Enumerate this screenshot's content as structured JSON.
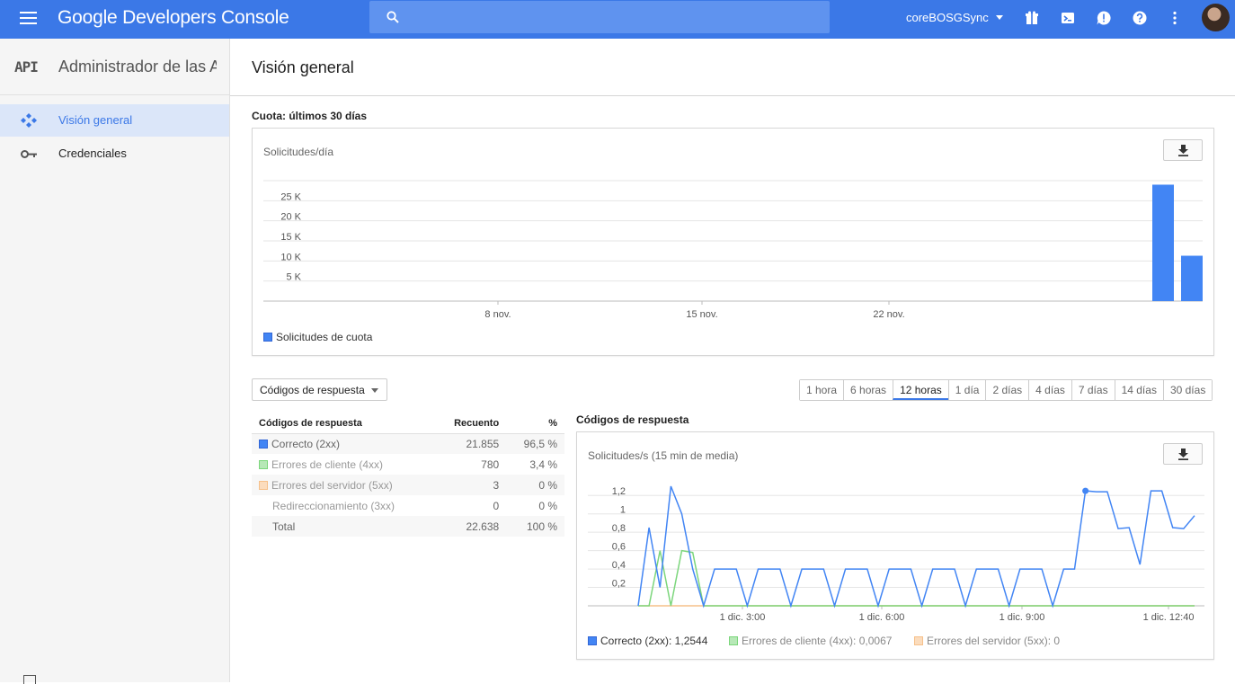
{
  "header": {
    "app_title": "Google Developers Console",
    "search_placeholder": "",
    "project_name": "coreBOSGSync",
    "colors": {
      "bar": "#3b78e7",
      "search": "#5f93ef"
    },
    "icons": [
      "gift-icon",
      "cloud-shell-icon",
      "notifications-icon",
      "help-icon",
      "more-vert-icon",
      "avatar"
    ]
  },
  "sidebar": {
    "logo": "API",
    "title": "Administrador de las API",
    "items": [
      {
        "label": "Visión general",
        "icon": "overview-icon",
        "active": true
      },
      {
        "label": "Credenciales",
        "icon": "key-icon",
        "active": false
      }
    ]
  },
  "main": {
    "page_title": "Visión general",
    "quota_section_title": "Cuota: últimos 30 días",
    "quota_chart_subtitle": "Solicitudes/día",
    "response_dropdown": "Códigos de respuesta",
    "time_ranges": [
      "1 hora",
      "6 horas",
      "12 horas",
      "1 día",
      "2 días",
      "4 días",
      "7 días",
      "14 días",
      "30 días"
    ],
    "active_range": "12 horas",
    "response_table": {
      "headers": [
        "Códigos de respuesta",
        "Recuento",
        "%"
      ],
      "rows": [
        {
          "label": "Correcto (2xx)",
          "count": "21.855",
          "pct": "96,5 %",
          "color": "#4285f4"
        },
        {
          "label": "Errores de cliente (4xx)",
          "count": "780",
          "pct": "3,4 %",
          "color": "#7cd67c"
        },
        {
          "label": "Errores del servidor (5xx)",
          "count": "3",
          "pct": "0 %",
          "color": "#f6c08a"
        },
        {
          "label": "Redireccionamiento (3xx)",
          "count": "0",
          "pct": "0 %",
          "color": ""
        }
      ],
      "total": {
        "label": "Total",
        "count": "22.638",
        "pct": "100 %"
      }
    },
    "response_chart_title": "Códigos de respuesta",
    "response_chart_subtitle": "Solicitudes/s (15 min de media)"
  },
  "chart_data": [
    {
      "type": "bar",
      "title": "Cuota: últimos 30 días",
      "ylabel": "Solicitudes/día",
      "y_ticks": [
        "5 K",
        "10 K",
        "15 K",
        "20 K",
        "25 K"
      ],
      "x_ticks": [
        "8 nov.",
        "15 nov.",
        "22 nov."
      ],
      "ylim": [
        0,
        30000
      ],
      "series": [
        {
          "name": "Solicitudes de cuota",
          "color": "#4285f4",
          "values": [
            29000,
            11300
          ]
        }
      ],
      "legend": "bottom-left",
      "grid": true
    },
    {
      "type": "line",
      "title": "Códigos de respuesta",
      "ylabel": "Solicitudes/s (15 min de media)",
      "y_ticks": [
        "0,2",
        "0,4",
        "0,6",
        "0,8",
        "1",
        "1,2"
      ],
      "x_ticks": [
        "1 dic. 3:00",
        "1 dic. 6:00",
        "1 dic. 9:00",
        "1 dic. 12:40"
      ],
      "ylim": [
        0,
        1.3
      ],
      "legend": "bottom-left",
      "grid": true,
      "series": [
        {
          "name": "Correcto (2xx)",
          "legend_value": "Correcto (2xx): 1,2544",
          "color": "#4285f4",
          "values": [
            0,
            0.85,
            0.2,
            1.3,
            1.0,
            0.4,
            0,
            0.4,
            0.4,
            0.4,
            0,
            0.4,
            0.4,
            0.4,
            0,
            0.4,
            0.4,
            0.4,
            0,
            0.4,
            0.4,
            0.4,
            0,
            0.4,
            0.4,
            0.4,
            0,
            0.4,
            0.4,
            0.4,
            0,
            0.4,
            0.4,
            0.4,
            0,
            0.4,
            0.4,
            0.4,
            0,
            0.4,
            0.4,
            1.25,
            1.24,
            1.24,
            0.84,
            0.85,
            0.45,
            1.25,
            1.25,
            0.85,
            0.84,
            0.98
          ]
        },
        {
          "name": "Errores de cliente (4xx)",
          "legend_value": "Errores de cliente (4xx): 0,0067",
          "color": "#7cd67c",
          "values": [
            0,
            0,
            0.6,
            0,
            0.6,
            0.58,
            0,
            0,
            0,
            0,
            0,
            0,
            0,
            0,
            0,
            0,
            0,
            0,
            0,
            0,
            0,
            0,
            0,
            0,
            0,
            0,
            0,
            0,
            0,
            0,
            0,
            0,
            0,
            0,
            0,
            0,
            0,
            0,
            0,
            0,
            0,
            0,
            0,
            0,
            0,
            0,
            0,
            0,
            0,
            0,
            0,
            0
          ]
        },
        {
          "name": "Errores del servidor (5xx)",
          "legend_value": "Errores del servidor (5xx): 0",
          "color": "#f6c08a",
          "values": [
            0,
            0,
            0,
            0,
            0,
            0,
            0,
            0,
            0,
            0,
            0,
            0,
            0,
            0,
            0,
            0,
            0,
            0,
            0,
            0,
            0,
            0,
            0,
            0,
            0,
            0,
            0,
            0,
            0,
            0,
            0,
            0,
            0,
            0,
            0,
            0,
            0,
            0,
            0,
            0,
            0,
            0,
            0,
            0,
            0,
            0,
            0,
            0,
            0,
            0,
            0,
            0
          ]
        }
      ]
    }
  ]
}
